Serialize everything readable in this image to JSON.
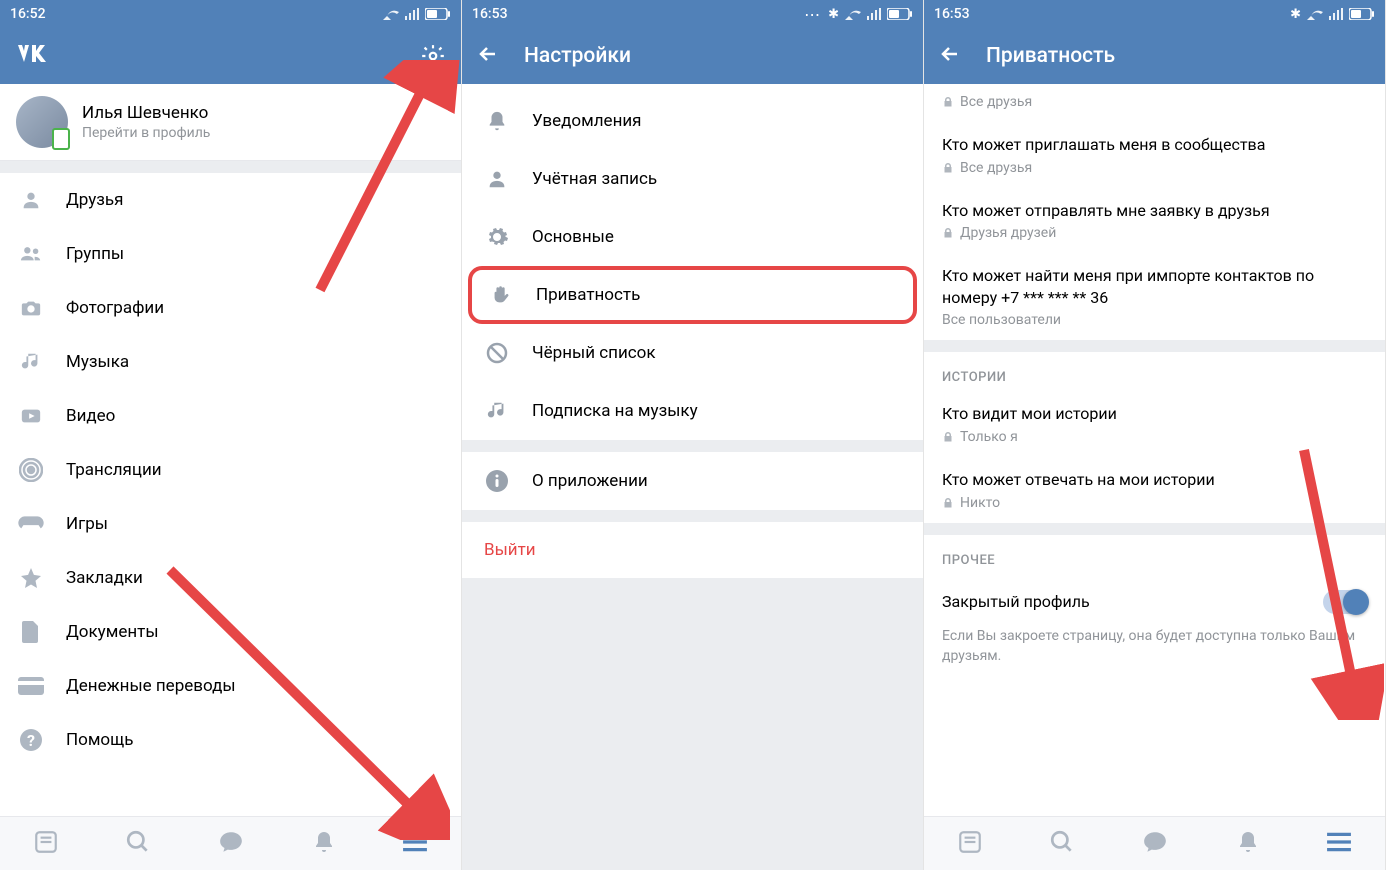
{
  "screen1": {
    "time": "16:52",
    "profile_name": "Илья Шевченко",
    "profile_sub": "Перейти в профиль",
    "menu": [
      {
        "id": "friends",
        "label": "Друзья",
        "icon": "person"
      },
      {
        "id": "groups",
        "label": "Группы",
        "icon": "people"
      },
      {
        "id": "photos",
        "label": "Фотографии",
        "icon": "camera"
      },
      {
        "id": "music",
        "label": "Музыка",
        "icon": "music"
      },
      {
        "id": "video",
        "label": "Видео",
        "icon": "video"
      },
      {
        "id": "live",
        "label": "Трансляции",
        "icon": "live"
      },
      {
        "id": "games",
        "label": "Игры",
        "icon": "gamepad"
      },
      {
        "id": "bookmarks",
        "label": "Закладки",
        "icon": "star"
      },
      {
        "id": "docs",
        "label": "Документы",
        "icon": "doc"
      },
      {
        "id": "money",
        "label": "Денежные переводы",
        "icon": "card"
      },
      {
        "id": "help",
        "label": "Помощь",
        "icon": "help"
      }
    ]
  },
  "screen2": {
    "time": "16:53",
    "title": "Настройки",
    "items": [
      {
        "id": "notifications",
        "label": "Уведомления",
        "icon": "bell"
      },
      {
        "id": "account",
        "label": "Учётная запись",
        "icon": "account"
      },
      {
        "id": "general",
        "label": "Основные",
        "icon": "gear"
      },
      {
        "id": "privacy",
        "label": "Приватность",
        "icon": "hand",
        "highlight": true
      },
      {
        "id": "blacklist",
        "label": "Чёрный список",
        "icon": "block"
      },
      {
        "id": "music_sub",
        "label": "Подписка на музыку",
        "icon": "music"
      }
    ],
    "about_label": "О приложении",
    "logout_label": "Выйти"
  },
  "screen3": {
    "time": "16:53",
    "title": "Приватность",
    "top_value": "Все друзья",
    "items": [
      {
        "title": "Кто может приглашать меня в сообщества",
        "value": "Все друзья",
        "lock": true
      },
      {
        "title": "Кто может отправлять мне заявку в друзья",
        "value": "Друзья друзей",
        "lock": true
      },
      {
        "title": "Кто может найти меня при импорте контактов по номеру +7 *** *** ** 36",
        "value": "Все пользователи",
        "lock": false
      }
    ],
    "stories_header": "ИСТОРИИ",
    "stories": [
      {
        "title": "Кто видит мои истории",
        "value": "Только я",
        "lock": true
      },
      {
        "title": "Кто может отвечать на мои истории",
        "value": "Никто",
        "lock": true
      }
    ],
    "other_header": "ПРОЧЕЕ",
    "toggle_label": "Закрытый профиль",
    "toggle_on": true,
    "hint": "Если Вы закроете страницу, она будет доступна только Вашим друзьям."
  }
}
